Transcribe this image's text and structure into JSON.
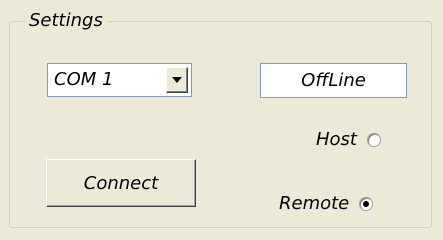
{
  "settings": {
    "title": "Settings",
    "port": {
      "selected": "COM 1"
    },
    "status": "OffLine",
    "connect_label": "Connect",
    "mode": {
      "host_label": "Host",
      "remote_label": "Remote",
      "selected": "Remote"
    }
  }
}
